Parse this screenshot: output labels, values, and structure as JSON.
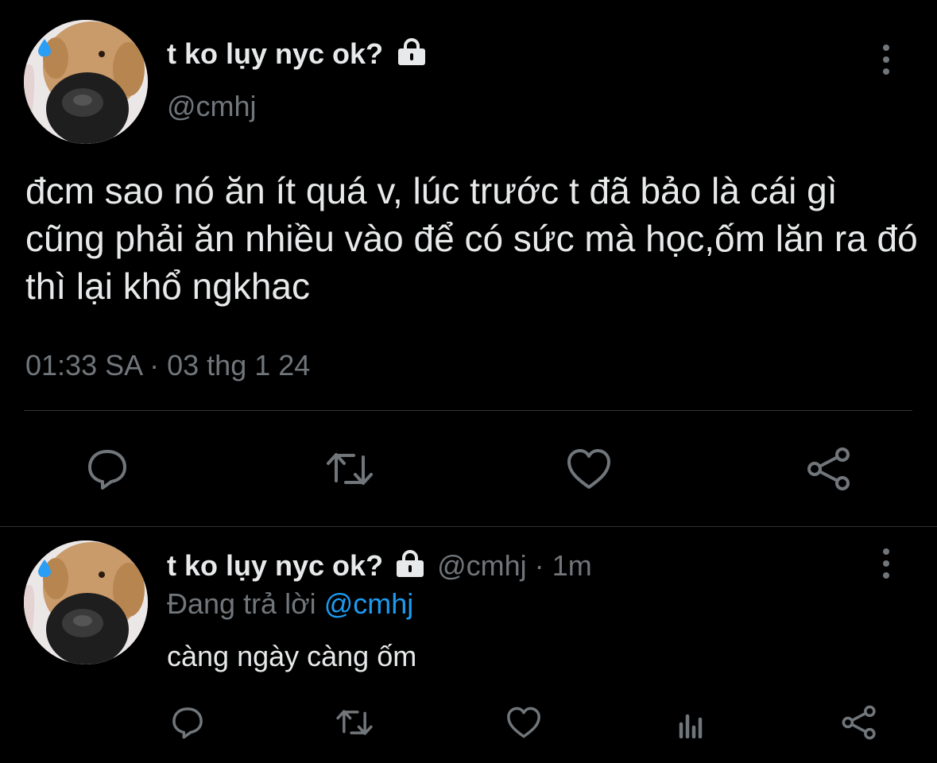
{
  "main_tweet": {
    "author_name": "t ko lụy nyc ok?",
    "author_handle": "@cmhj",
    "lock_icon": "lock-icon",
    "text": "đcm sao nó ăn ít quá v, lúc trước t đã bảo là cái gì cũng phải ăn nhiều vào để có sức mà học,ốm lăn ra đó thì lại khổ ngkhac",
    "timestamp": "01:33 SA · 03 thg 1 24",
    "actions": [
      "reply-icon",
      "retweet-icon",
      "like-icon",
      "share-icon"
    ]
  },
  "reply_tweet": {
    "author_name": "t ko lụy nyc ok?",
    "author_handle": "@cmhj",
    "separator": "·",
    "time_ago": "1m",
    "replying_to_label": "Đang trả lời",
    "replying_to_handle": "@cmhj",
    "text": "càng ngày càng ốm",
    "actions": [
      "reply-icon",
      "retweet-icon",
      "like-icon",
      "analytics-icon",
      "share-icon"
    ]
  },
  "colors": {
    "background": "#000000",
    "text": "#e7e9ea",
    "muted": "#71767b",
    "link": "#1d9bf0",
    "divider": "#2f3336"
  }
}
